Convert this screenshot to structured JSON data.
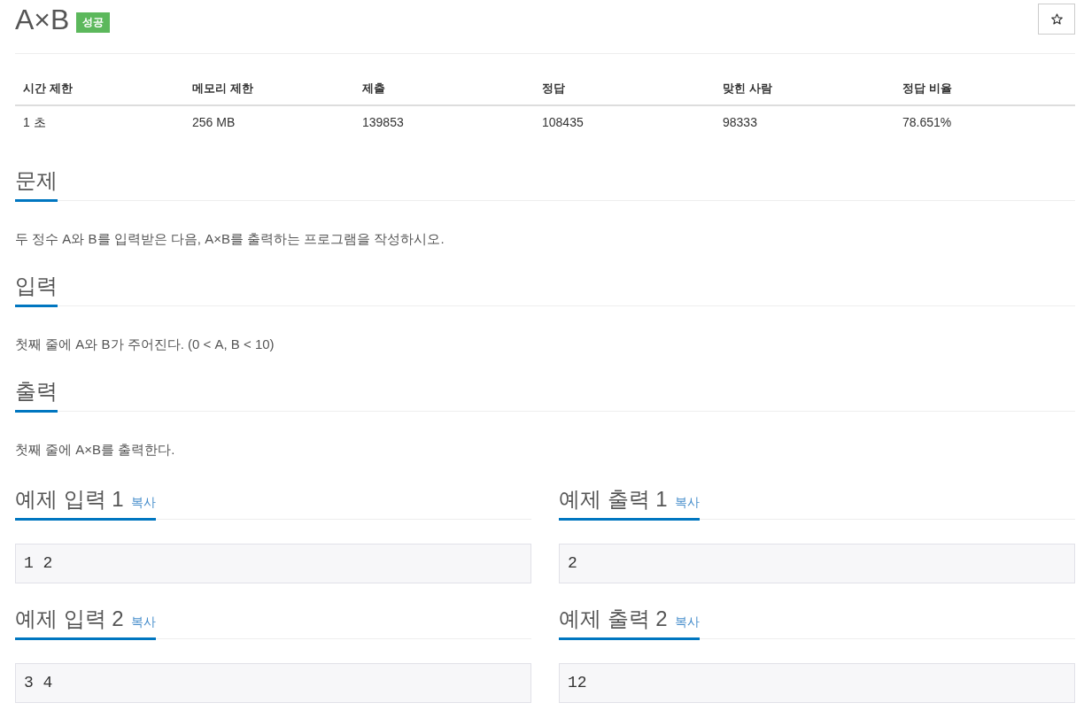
{
  "problem": {
    "title": "A×B",
    "result_badge": "성공",
    "starred": false
  },
  "limits_table": {
    "columns": [
      "시간 제한",
      "메모리 제한",
      "제출",
      "정답",
      "맞힌 사람",
      "정답 비율"
    ],
    "rows": [
      [
        "1 초",
        "256 MB",
        "139853",
        "108435",
        "98333",
        "78.651%"
      ]
    ]
  },
  "sections": [
    {
      "heading": "문제",
      "body": "두 정수 A와 B를 입력받은 다음, A×B를 출력하는 프로그램을 작성하시오."
    },
    {
      "heading": "입력",
      "body": "첫째 줄에 A와 B가 주어진다. (0 < A, B < 10)"
    },
    {
      "heading": "출력",
      "body": "첫째 줄에 A×B를 출력한다."
    }
  ],
  "samples": [
    {
      "heading": "예제 입력 1",
      "copy_link": "복사",
      "data": "1 2"
    },
    {
      "heading": "예제 출력 1",
      "copy_link": "복사",
      "data": "2"
    },
    {
      "heading": "예제 입력 2",
      "copy_link": "복사",
      "data": "3 4"
    },
    {
      "heading": "예제 출력 2",
      "copy_link": "복사",
      "data": "12"
    }
  ]
}
